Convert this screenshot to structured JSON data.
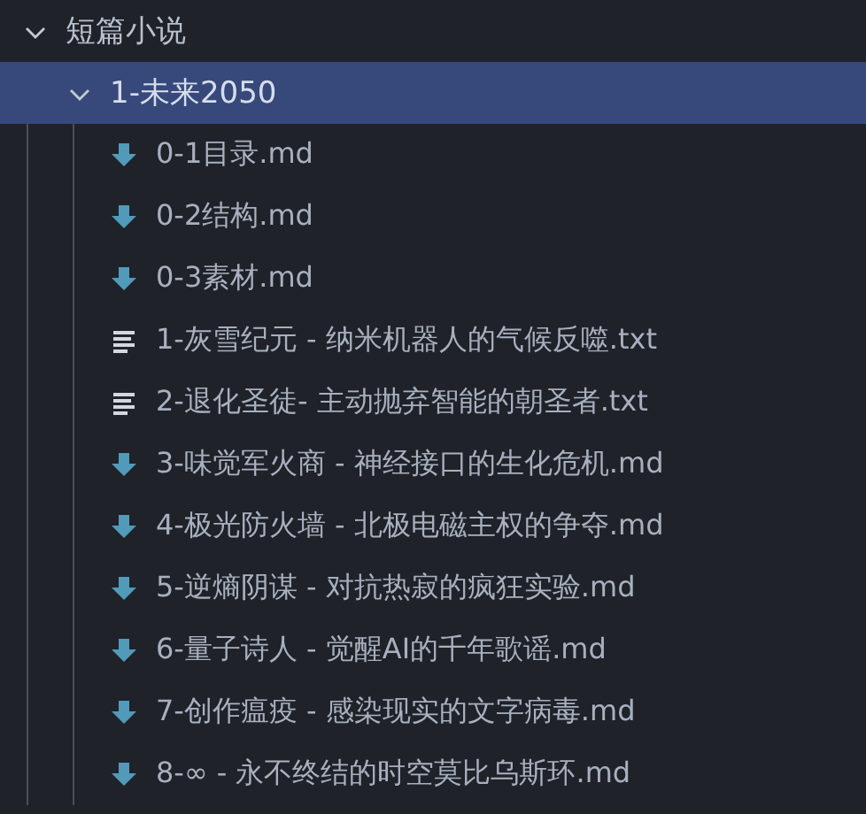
{
  "tree": [
    {
      "kind": "folder",
      "label": "短篇小说",
      "expanded": true,
      "selected": false,
      "children": [
        {
          "kind": "folder",
          "label": "1-未来2050",
          "expanded": true,
          "selected": true,
          "children": [
            {
              "kind": "md",
              "label": "0-1目录.md",
              "selected": false
            },
            {
              "kind": "md",
              "label": "0-2结构.md",
              "selected": false
            },
            {
              "kind": "md",
              "label": "0-3素材.md",
              "selected": false
            },
            {
              "kind": "txt",
              "label": "1-灰雪纪元 - 纳米机器人的气候反噬.txt",
              "selected": false
            },
            {
              "kind": "txt",
              "label": "2-退化圣徒- 主动抛弃智能的朝圣者.txt",
              "selected": false
            },
            {
              "kind": "md",
              "label": "3-味觉军火商 - 神经接口的生化危机.md",
              "selected": false
            },
            {
              "kind": "md",
              "label": "4-极光防火墙 - 北极电磁主权的争夺.md",
              "selected": false
            },
            {
              "kind": "md",
              "label": "5-逆熵阴谋 - 对抗热寂的疯狂实验.md",
              "selected": false
            },
            {
              "kind": "md",
              "label": "6-量子诗人 - 觉醒AI的千年歌谣.md",
              "selected": false
            },
            {
              "kind": "md",
              "label": "7-创作瘟疫 - 感染现实的文字病毒.md",
              "selected": false
            },
            {
              "kind": "md",
              "label": "8-∞ - 永不终结的时空莫比乌斯环.md",
              "selected": false
            }
          ]
        }
      ]
    }
  ]
}
